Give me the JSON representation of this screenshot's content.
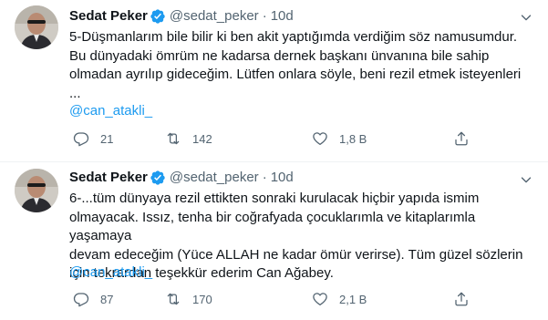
{
  "tweets": [
    {
      "author": {
        "name": "Sedat Peker",
        "handle": "@sedat_peker",
        "verified": true
      },
      "separator": "·",
      "time": "10d",
      "text": "5-Düşmanlarım bile bilir ki ben akit yaptığımda verdiğim söz namusumdur.\nBu dünyadaki ömrüm ne kadarsa dernek başkanı ünvanına bile sahip\nolmadan ayrılıp gideceğim. Lütfen onlara söyle, beni rezil etmek isteyenleri\n...",
      "mention": "@can_atakli_",
      "actions": {
        "replies": "21",
        "retweets": "142",
        "likes": "1,8 B"
      }
    },
    {
      "author": {
        "name": "Sedat Peker",
        "handle": "@sedat_peker",
        "verified": true
      },
      "separator": "·",
      "time": "10d",
      "text": "6-...tüm dünyaya rezil ettikten sonraki kurulacak hiçbir yapıda ismim\nolmayacak. Issız, tenha bir coğrafyada çocuklarımla ve kitaplarımla yaşamaya\ndevam edeceğim (Yüce ALLAH ne kadar ömür verirse). Tüm güzel sözlerin\niçin tekrardan teşekkür ederim Can Ağabey.",
      "mention": "@can_atakli_",
      "actions": {
        "replies": "87",
        "retweets": "170",
        "likes": "2,1 B"
      }
    }
  ],
  "colors": {
    "text": "#0f1419",
    "secondary": "#536471",
    "link": "#1d9bf0",
    "verified": "#1d9bf0",
    "divider": "#eff3f4"
  },
  "icons": [
    "avatar",
    "verified-badge-icon",
    "more-options-icon",
    "reply-icon",
    "retweet-icon",
    "like-icon",
    "share-icon"
  ]
}
